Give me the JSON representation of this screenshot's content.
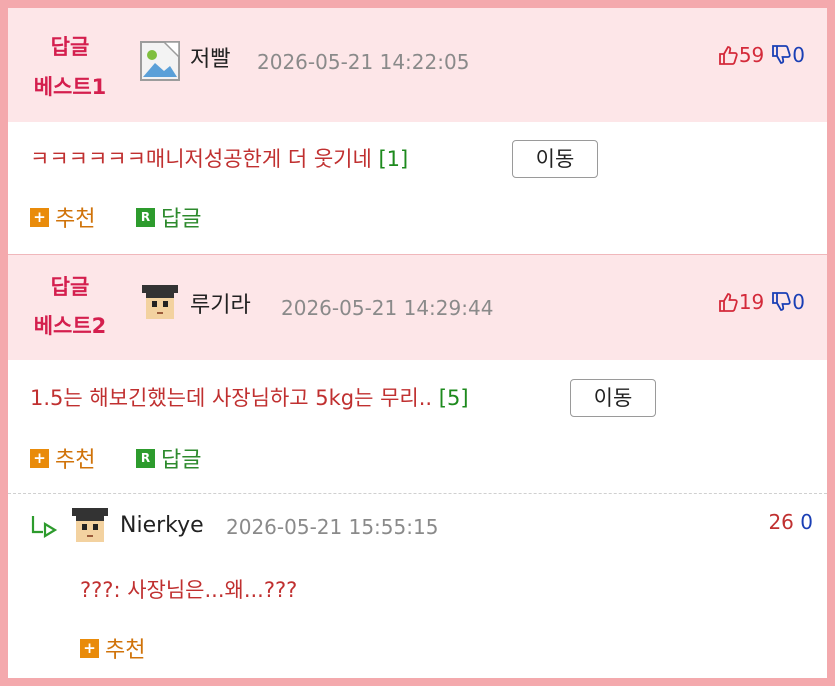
{
  "comments": [
    {
      "badge_line1": "답글",
      "badge_line2": "베스트1",
      "nickname": "저빨",
      "date": "2026-05-21 14:22:05",
      "up": "59",
      "down": "0",
      "text": "ㅋㅋㅋㅋㅋㅋ매니저성공한게 더 웃기네",
      "reply_count": "[1]",
      "move_label": "이동",
      "recommend_label": "추천",
      "reply_label": "답글"
    },
    {
      "badge_line1": "답글",
      "badge_line2": "베스트2",
      "nickname": "루기라",
      "date": "2026-05-21 14:29:44",
      "up": "19",
      "down": "0",
      "text": "1.5는 해보긴했는데 사장님하고 5kg는 무리..",
      "reply_count": "[5]",
      "move_label": "이동",
      "recommend_label": "추천",
      "reply_label": "답글"
    }
  ],
  "reply": {
    "nickname": "Nierkye",
    "date": "2026-05-21 15:55:15",
    "up": "26",
    "down": "0",
    "text": "???: 사장님은...왜...???",
    "recommend_label": "추천"
  },
  "colors": {
    "accent": "#d41f4e",
    "up": "#d42a3a",
    "down": "#1a3fb5",
    "recommend": "#e98b0a",
    "reply": "#2d9b2d"
  }
}
